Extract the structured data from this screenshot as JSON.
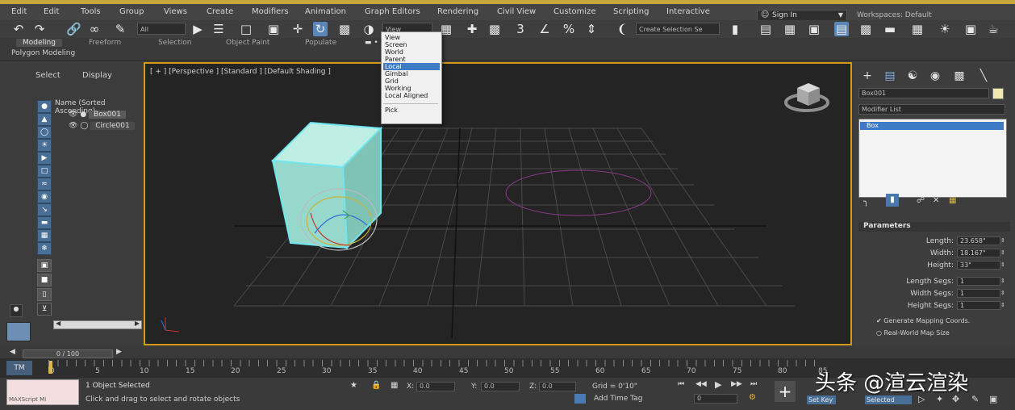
{
  "menu": [
    "Edit",
    "Edit",
    "Tools",
    "Group",
    "Views",
    "Create",
    "Modifiers",
    "Animation",
    "Graph Editors",
    "Rendering",
    "Civil View",
    "Customize",
    "Scripting",
    "Interactive"
  ],
  "signin": "Sign In",
  "workspace": "Workspaces: Default",
  "toolbar": {
    "filter_field": "All",
    "refcoord_field": "View",
    "selection_set": "Create Selection Se"
  },
  "ribbon": {
    "tabs": [
      "Modeling",
      "Freeform",
      "Selection",
      "Object Paint",
      "Populate"
    ],
    "active_tab": "Modeling",
    "subtab": "Polygon Modeling"
  },
  "dropdown": {
    "items": [
      "View",
      "Screen",
      "World",
      "Parent",
      "Local",
      "Gimbal",
      "Grid",
      "Working",
      "Local Aligned",
      "Pick"
    ],
    "selected": "Local"
  },
  "left_panel": {
    "tabs": [
      "Select",
      "Display"
    ],
    "scene_title": "Name (Sorted Ascending)",
    "objects": [
      "Box001",
      "Circle001"
    ],
    "scroll_value": ""
  },
  "viewport": {
    "label": "[ + ] [Perspective ] [Standard ] [Default Shading ]"
  },
  "right_panel": {
    "object_name": "Box001",
    "modifier_list": "Modifier List",
    "stack_item": "Box",
    "rollout_title": "Parameters",
    "params": [
      {
        "label": "Length:",
        "value": "23.658\""
      },
      {
        "label": "Width:",
        "value": "18.167\""
      },
      {
        "label": "Height:",
        "value": "33\""
      },
      {
        "label": "Length Segs:",
        "value": "1"
      },
      {
        "label": "Width Segs:",
        "value": "1"
      },
      {
        "label": "Height Segs:",
        "value": "1"
      }
    ],
    "check1": "Generate Mapping Coords.",
    "check2": "Real-World Map Size",
    "color_swatch": "#f2e9b0"
  },
  "timeline": {
    "slider_text": "0 / 100",
    "start": "TM",
    "ticks": [
      "0",
      "5",
      "10",
      "15",
      "20",
      "25",
      "30",
      "35",
      "40",
      "45",
      "50",
      "55",
      "60",
      "65",
      "70",
      "75",
      "80",
      "85"
    ]
  },
  "status": {
    "maxscript": "MAXScript Mi",
    "selected": "1 Object Selected",
    "hint": "Click and drag to select and rotate objects",
    "x_label": "X:",
    "x_value": "0.0",
    "y_label": "Y:",
    "y_value": "0.0",
    "z_label": "Z:",
    "z_value": "0.0",
    "grid": "Grid = 0'10\"",
    "add_time_tag": "Add Time Tag",
    "frame": "0",
    "autokey": "Set Key",
    "keyfilters": "Selected"
  },
  "watermark": "头条 @渲云渲染",
  "colors": {
    "accent": "#3d7bc4",
    "viewport_border": "#d49a1a",
    "box_fill": "#8ed3c6",
    "box_edge": "#6fe6f0"
  }
}
